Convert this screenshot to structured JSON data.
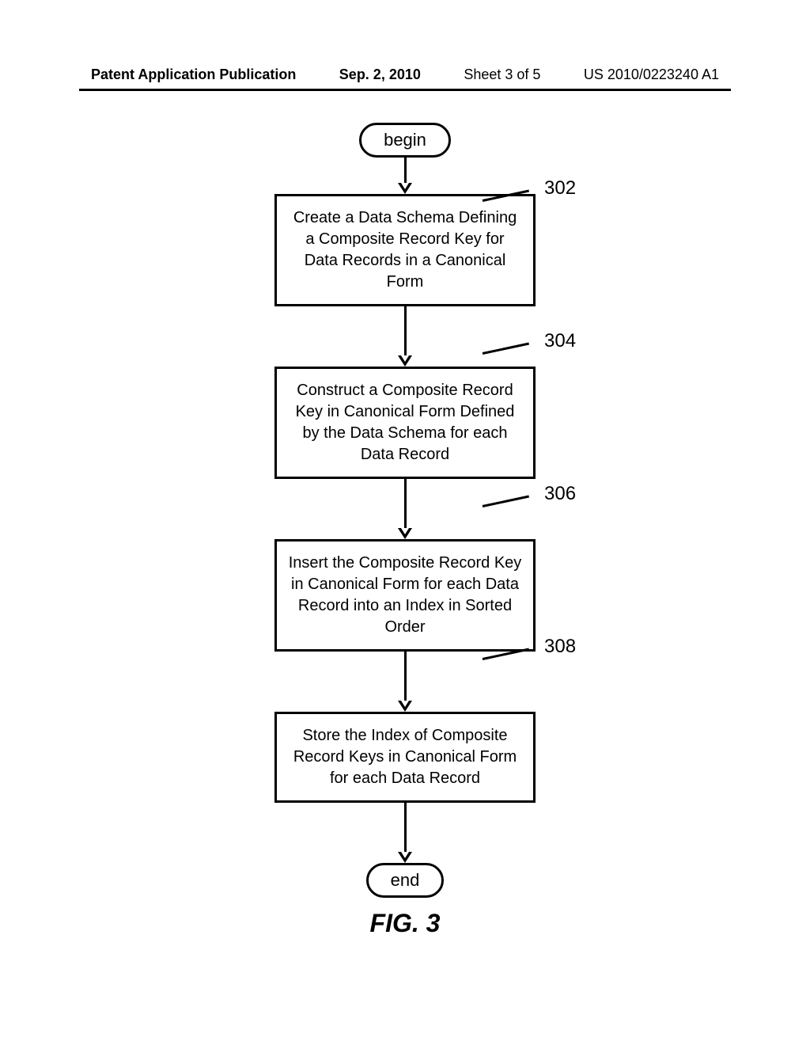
{
  "header": {
    "left": "Patent Application Publication",
    "date": "Sep. 2, 2010",
    "sheet": "Sheet 3 of 5",
    "pubno": "US 2010/0223240 A1"
  },
  "flow": {
    "begin": "begin",
    "end": "end",
    "steps": [
      {
        "ref": "302",
        "text": "Create a Data Schema Defining a Composite Record Key for Data Records in a Canonical Form"
      },
      {
        "ref": "304",
        "text": "Construct a Composite Record Key in Canonical Form Defined by the Data Schema for each Data Record"
      },
      {
        "ref": "306",
        "text": "Insert the Composite Record Key in Canonical Form for each Data Record  into an Index in Sorted Order"
      },
      {
        "ref": "308",
        "text": "Store the Index of Composite Record Keys in Canonical Form for each Data Record"
      }
    ]
  },
  "figure": "FIG. 3"
}
